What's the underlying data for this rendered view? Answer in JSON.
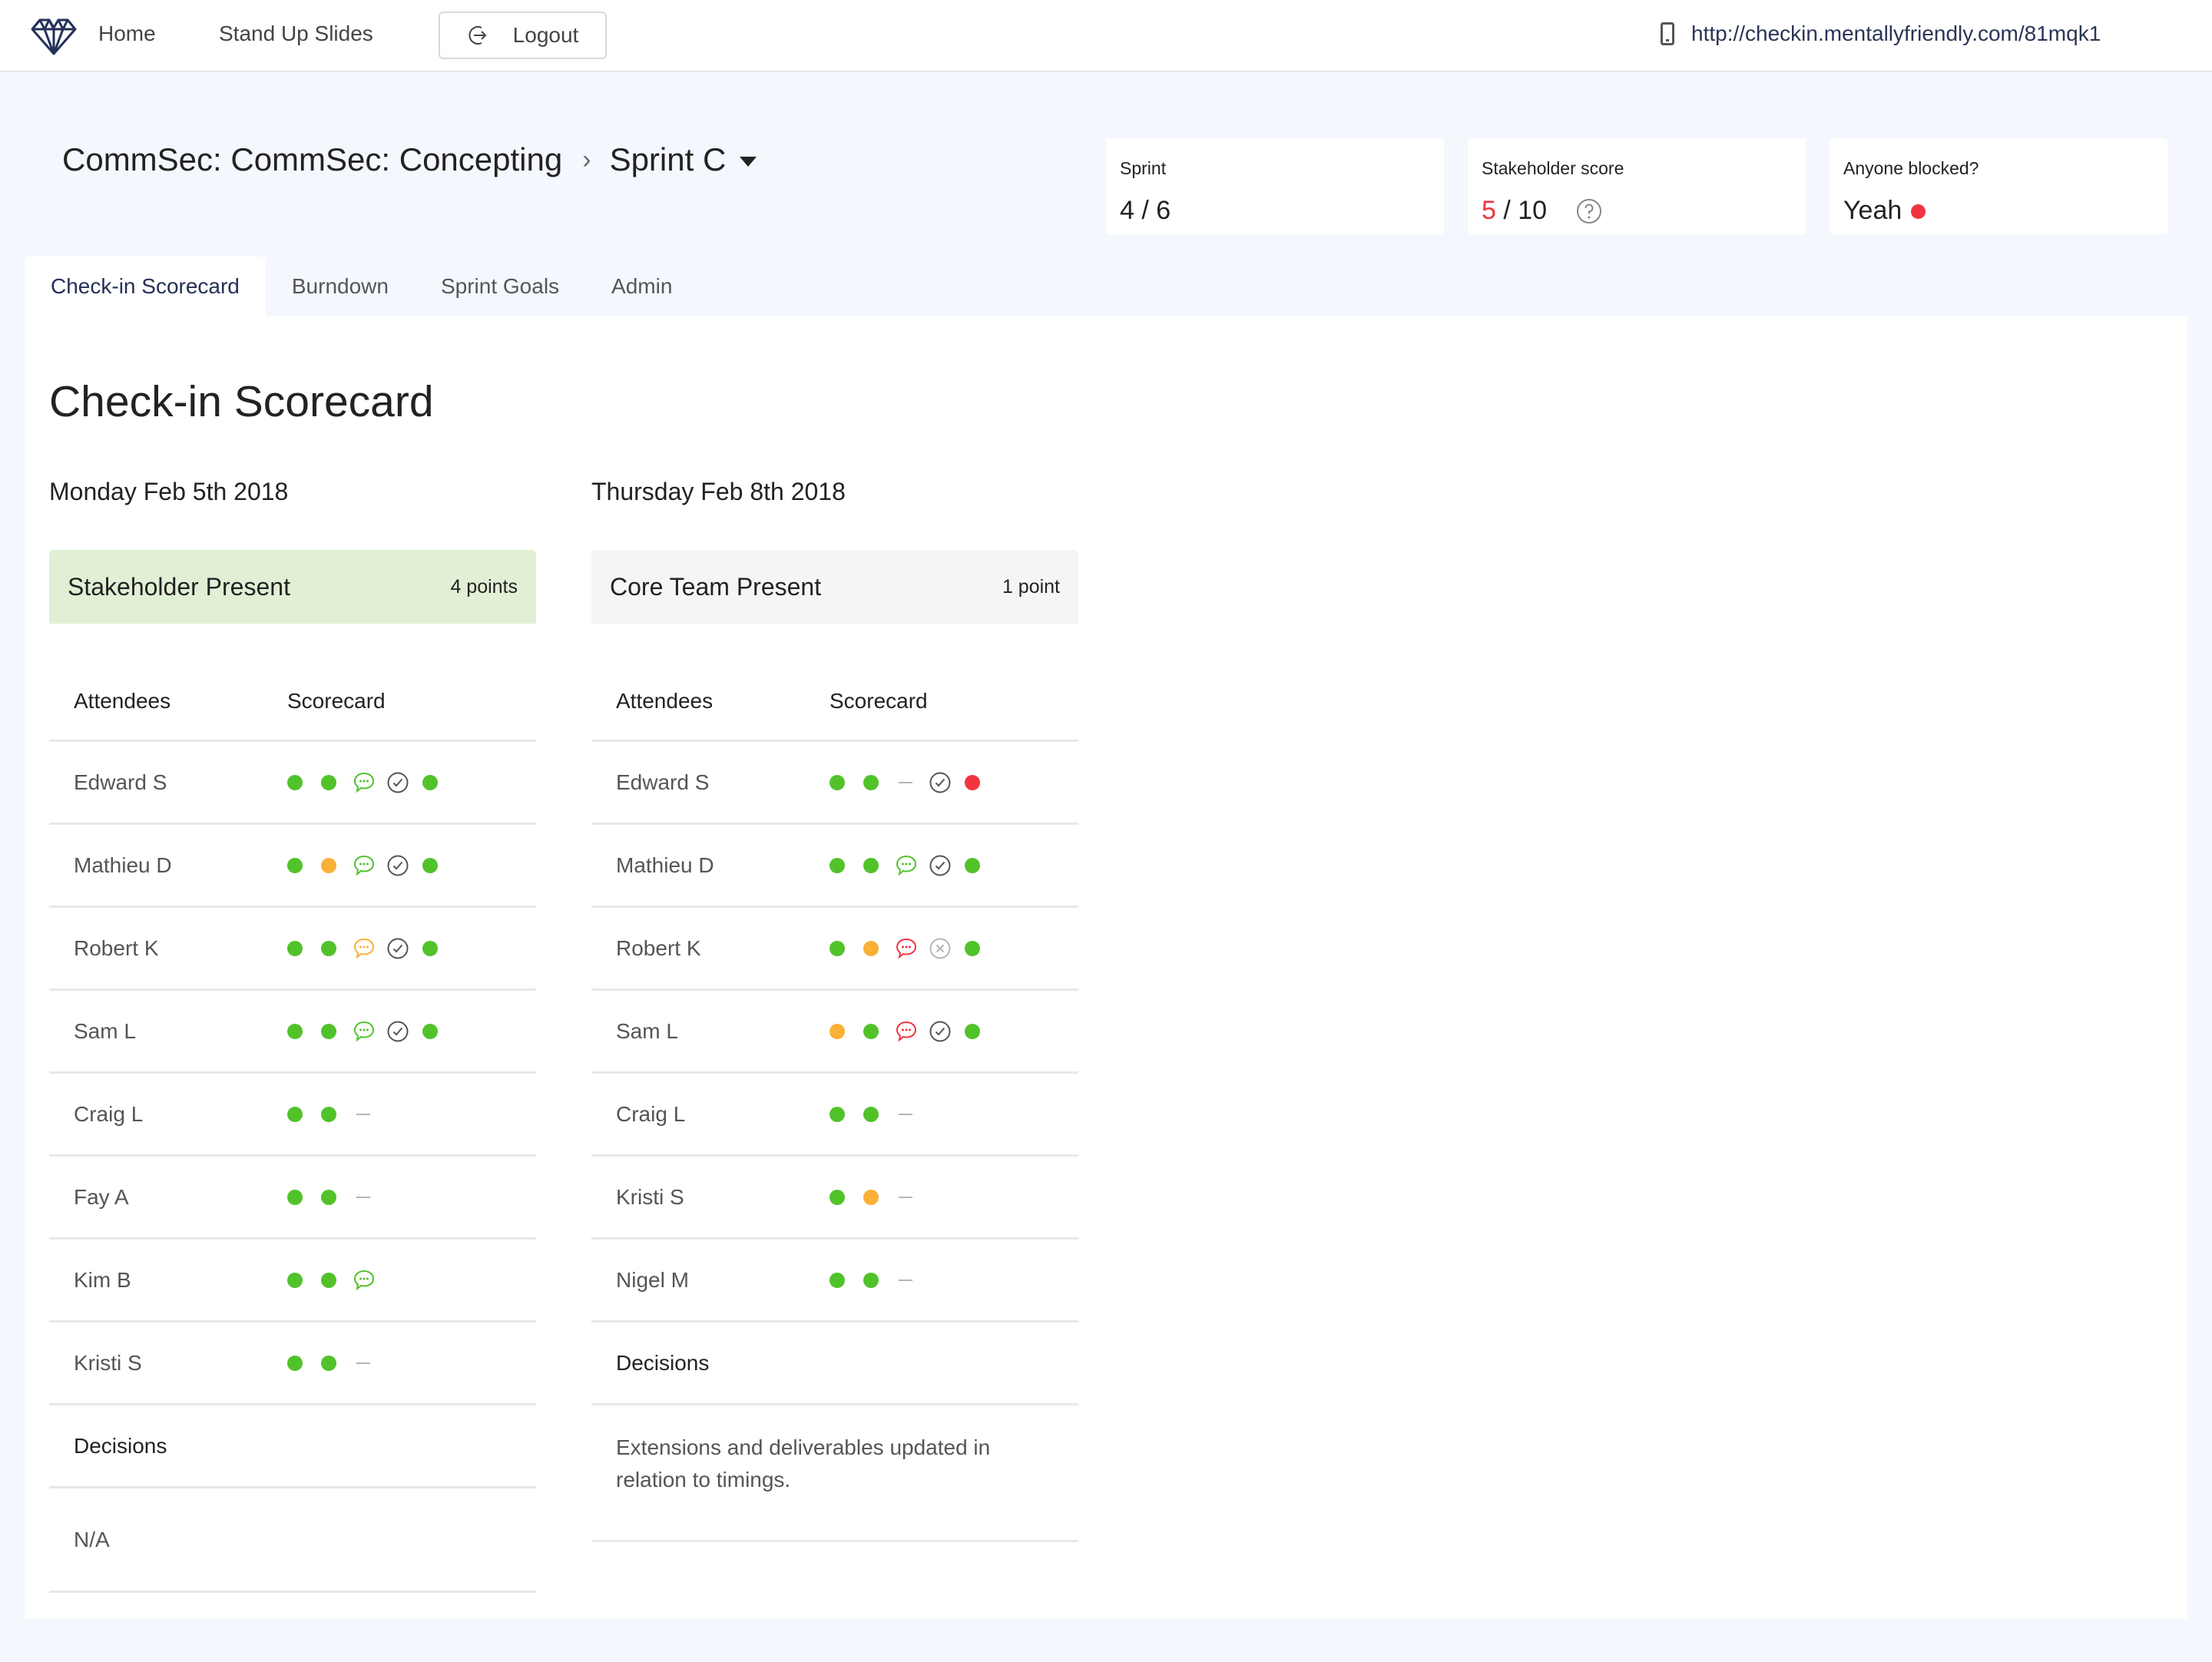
{
  "nav": {
    "logo": "diamond-heart-logo",
    "home": "Home",
    "stand_up_slides": "Stand Up Slides",
    "logout": "Logout",
    "checkin_url": "http://checkin.mentallyfriendly.com/81mqk1"
  },
  "breadcrumb": {
    "project": "CommSec: CommSec: Concepting",
    "separator": ">",
    "sprint": "Sprint C"
  },
  "stats": {
    "sprint": {
      "label": "Sprint",
      "current": "4",
      "sep": " / ",
      "total": "6"
    },
    "stakeholder_score": {
      "label": "Stakeholder score",
      "score": "5",
      "sep": " / ",
      "total": "10"
    },
    "blocked": {
      "label": "Anyone blocked?",
      "value": "Yeah",
      "status_color": "#f1343f"
    }
  },
  "tabs": [
    {
      "label": "Check-in Scorecard",
      "active": true
    },
    {
      "label": "Burndown",
      "active": false
    },
    {
      "label": "Sprint Goals",
      "active": false
    },
    {
      "label": "Admin",
      "active": false
    }
  ],
  "page_title": "Check-in Scorecard",
  "colors": {
    "green": "#52c22b",
    "orange": "#f9b037",
    "red": "#f1343f",
    "dark": "#555555",
    "muted": "#b5b5b5",
    "present_green_bg": "#e1f0d4",
    "present_grey_bg": "#f5f5f5"
  },
  "checkins": [
    {
      "date": "Monday Feb 5th 2018",
      "present_title": "Stakeholder Present",
      "present_points": "4 points",
      "present_style": "green",
      "headers": {
        "attendees": "Attendees",
        "scorecard": "Scorecard"
      },
      "attendees": [
        {
          "name": "Edward S",
          "marks": [
            "dot-green",
            "dot-green",
            "chat-green",
            "check",
            "dot-green"
          ]
        },
        {
          "name": "Mathieu D",
          "marks": [
            "dot-green",
            "dot-orange",
            "chat-green",
            "check",
            "dot-green"
          ]
        },
        {
          "name": "Robert K",
          "marks": [
            "dot-green",
            "dot-green",
            "chat-orange",
            "check",
            "dot-green"
          ]
        },
        {
          "name": "Sam L",
          "marks": [
            "dot-green",
            "dot-green",
            "chat-green",
            "check",
            "dot-green"
          ]
        },
        {
          "name": "Craig L",
          "marks": [
            "dot-green",
            "dot-green",
            "dash"
          ]
        },
        {
          "name": "Fay A",
          "marks": [
            "dot-green",
            "dot-green",
            "dash"
          ]
        },
        {
          "name": "Kim B",
          "marks": [
            "dot-green",
            "dot-green",
            "chat-green"
          ]
        },
        {
          "name": "Kristi S",
          "marks": [
            "dot-green",
            "dot-green",
            "dash"
          ]
        }
      ],
      "decisions_label": "Decisions",
      "decisions": "N/A"
    },
    {
      "date": "Thursday Feb 8th 2018",
      "present_title": "Core Team Present",
      "present_points": "1 point",
      "present_style": "grey",
      "headers": {
        "attendees": "Attendees",
        "scorecard": "Scorecard"
      },
      "attendees": [
        {
          "name": "Edward S",
          "marks": [
            "dot-green",
            "dot-green",
            "dash",
            "check",
            "dot-red"
          ]
        },
        {
          "name": "Mathieu D",
          "marks": [
            "dot-green",
            "dot-green",
            "chat-green",
            "check",
            "dot-green"
          ]
        },
        {
          "name": "Robert K",
          "marks": [
            "dot-green",
            "dot-orange",
            "chat-red",
            "cross",
            "dot-green"
          ]
        },
        {
          "name": "Sam L",
          "marks": [
            "dot-orange",
            "dot-green",
            "chat-red",
            "check",
            "dot-green"
          ]
        },
        {
          "name": "Craig L",
          "marks": [
            "dot-green",
            "dot-green",
            "dash"
          ]
        },
        {
          "name": "Kristi S",
          "marks": [
            "dot-green",
            "dot-orange",
            "dash"
          ]
        },
        {
          "name": "Nigel M",
          "marks": [
            "dot-green",
            "dot-green",
            "dash"
          ]
        }
      ],
      "decisions_label": "Decisions",
      "decisions": "Extensions and deliverables updated in relation to timings."
    }
  ]
}
